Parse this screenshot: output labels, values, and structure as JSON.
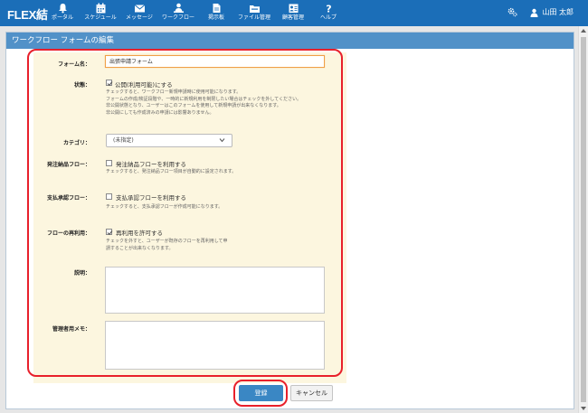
{
  "app": {
    "logo": "FLEX結"
  },
  "nav": [
    {
      "label": "ポータル",
      "icon": "bell-icon"
    },
    {
      "label": "スケジュール",
      "icon": "calendar-icon"
    },
    {
      "label": "メッセージ",
      "icon": "envelope-icon"
    },
    {
      "label": "ワークフロー",
      "icon": "workflow-icon"
    },
    {
      "label": "掲示板",
      "icon": "board-icon"
    },
    {
      "label": "ファイル管理",
      "icon": "folder-icon"
    },
    {
      "label": "顧客管理",
      "icon": "customer-icon"
    },
    {
      "label": "ヘルプ",
      "icon": "question-icon"
    }
  ],
  "user": {
    "name": "山田 太郎"
  },
  "page": {
    "title": "ワークフロー フォームの編集"
  },
  "form": {
    "form_name": {
      "label": "フォーム名：",
      "value": "出張申請フォーム"
    },
    "status": {
      "label": "状態：",
      "option": "公開(利用可能)にする",
      "checked": true,
      "help": [
        "チェックすると、ワークフロー新規申請時に使用可能になります。",
        "フォームの作成/検証段階や、一時的に新規利用を制限したい場合はチェックを外してください。",
        "非公開状態となり、ユーザーはこのフォームを使用して新規申請が出来なくなります。",
        "非公開にしても作成済みの申請には影響ありません。"
      ]
    },
    "category": {
      "label": "カテゴリ：",
      "value": "(未指定)"
    },
    "order_flow": {
      "label": "発注納品フロー：",
      "option": "発注納品フローを利用する",
      "checked": false,
      "help": "チェックすると、発注納品フロー項目が自動的に設定されます。"
    },
    "payment_flow": {
      "label": "支払承認フロー：",
      "option": "支払承認フローを利用する",
      "checked": false,
      "help": "チェックすると、支払承認フローが作成可能になります。"
    },
    "reuse": {
      "label": "フローの再利用：",
      "option": "再利用を許可する",
      "checked": true,
      "help": [
        "チェックを外すと、ユーザーが既存のフローを再利用して申",
        "請することが出来なくなります。"
      ]
    },
    "description": {
      "label": "説明：",
      "value": ""
    },
    "admin_memo": {
      "label": "管理者用メモ：",
      "value": ""
    }
  },
  "buttons": {
    "register": "登録",
    "cancel": "キャンセル"
  },
  "colors": {
    "topbar": "#1b6eb8",
    "panel_header": "#5191c8",
    "primary_button": "#3a87c4",
    "highlight": "#e8202b",
    "form_bg": "#fcf6df"
  }
}
